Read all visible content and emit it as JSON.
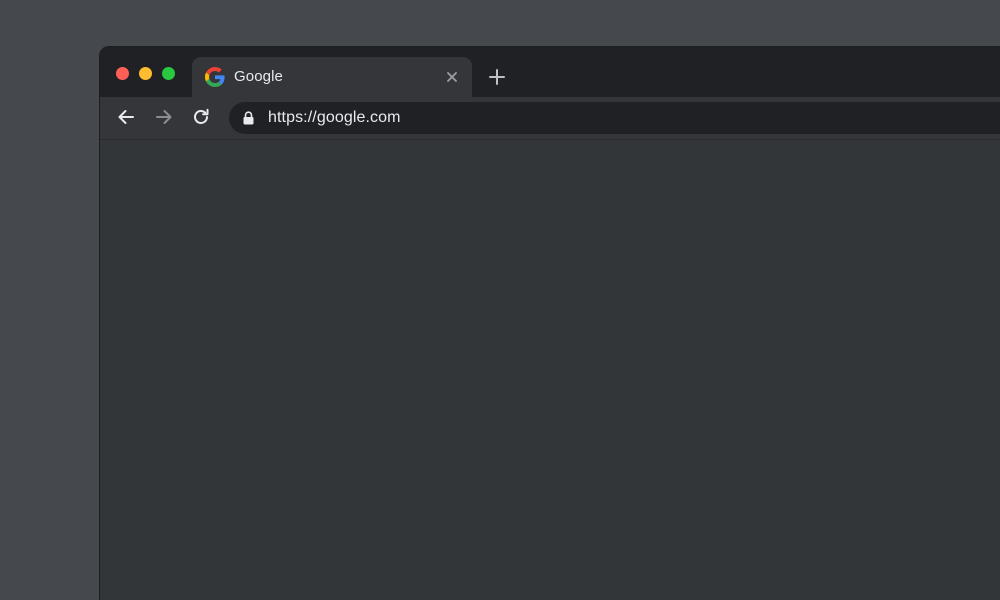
{
  "window": {
    "traffic_lights": {
      "close_color": "#ff5f57",
      "minimize_color": "#febc2e",
      "zoom_color": "#28c840"
    }
  },
  "tabs": [
    {
      "title": "Google",
      "favicon": "google-g-icon",
      "active": true
    }
  ],
  "toolbar": {
    "back_icon": "arrow-left-icon",
    "forward_icon": "arrow-right-icon",
    "reload_icon": "reload-icon",
    "new_tab_icon": "plus-icon"
  },
  "omnibox": {
    "url": "https://google.com",
    "security_icon": "lock-icon"
  },
  "colors": {
    "desktop": "#45484d",
    "titlebar": "#202124",
    "tab_active": "#35363a",
    "page_background": "#323639",
    "text": "#e8eaed"
  }
}
